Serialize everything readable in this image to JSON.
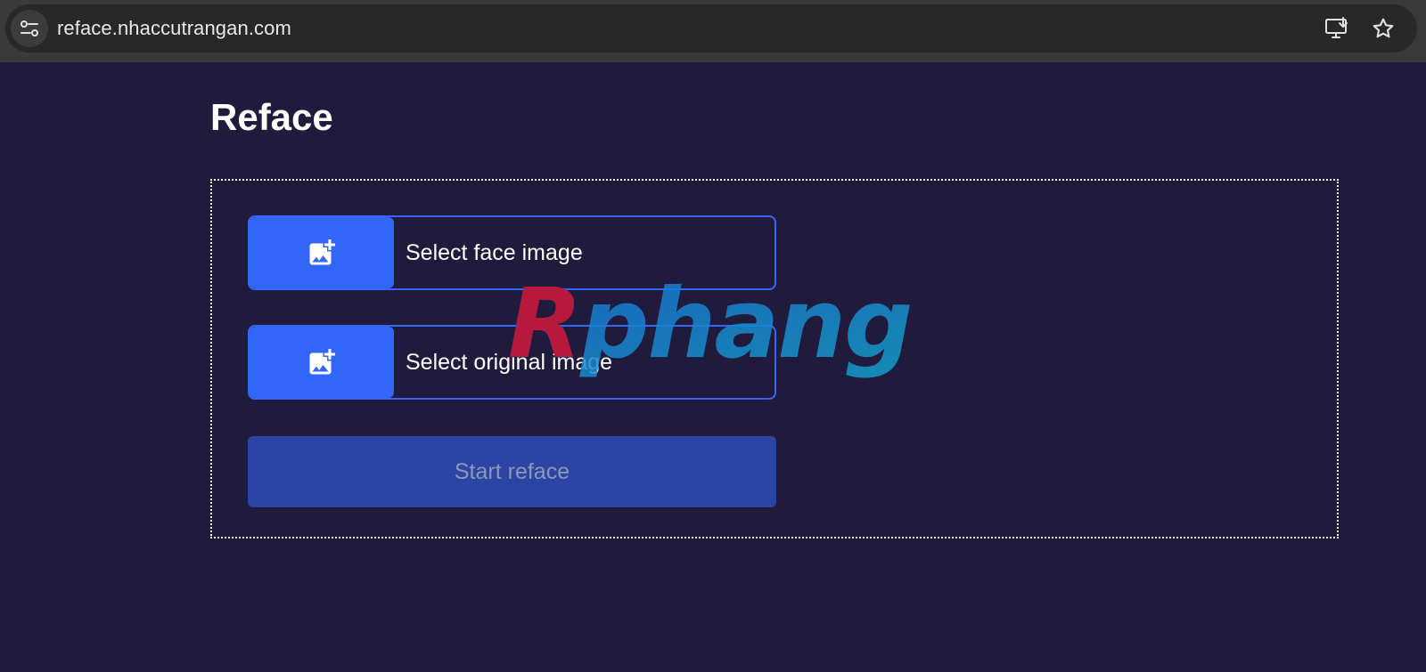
{
  "browser": {
    "url": "reface.nhaccutrangan.com",
    "icons": {
      "site_info": "tune-icon",
      "install": "install-app-icon",
      "bookmark": "star-icon"
    }
  },
  "page": {
    "title": "Reface",
    "select_face_label": "Select face image",
    "select_original_label": "Select original image",
    "start_label": "Start reface",
    "watermark_text": "Rphang"
  },
  "colors": {
    "page_background": "#201b3d",
    "accent": "#3266f8",
    "start_button": "#2a45a3",
    "start_text": "#8e96b8",
    "watermark_red": "#c8102e",
    "watermark_blue": "#1486c8"
  }
}
